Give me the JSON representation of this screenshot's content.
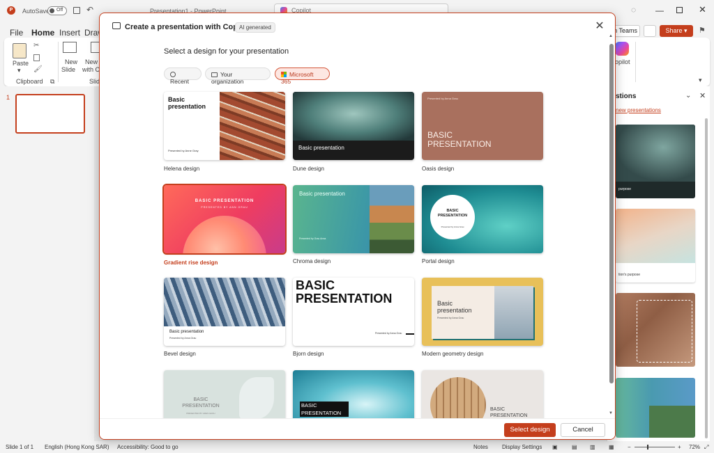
{
  "app": {
    "autosave_label": "AutoSave",
    "autosave_state": "Off",
    "doc_title": "Presentation1 - PowerPoint",
    "search_placeholder": "Copilot"
  },
  "ribbon_tabs": [
    "File",
    "Home",
    "Insert",
    "Draw"
  ],
  "ribbon": {
    "paste": "Paste",
    "clipboard": "Clipboard",
    "new_slide_1": "New",
    "new_slide_2": "Slide",
    "new_slide2_1": "New S",
    "new_slide2_2": "with C",
    "slides_group": "Slid",
    "teams": "n Teams",
    "share": "Share",
    "copilot": "opilot"
  },
  "slides_pane": {
    "slide_number": "1"
  },
  "side_pane": {
    "title": "stions",
    "link": "new presentations",
    "thumb1_text": "purpose",
    "thumb2_text": "tion's purpose"
  },
  "status": {
    "slide": "Slide 1 of 1",
    "language": "English (Hong Kong SAR)",
    "accessibility": "Accessibility: Good to go",
    "notes": "Notes",
    "display": "Display Settings",
    "zoom": "72%"
  },
  "dialog": {
    "title": "Create a presentation with Copilot",
    "badge": "AI generated",
    "heading": "Select a design for your presentation",
    "filters": [
      "Recent",
      "Your organization",
      "Microsoft 365"
    ],
    "select_button": "Select design",
    "cancel_button": "Cancel"
  },
  "designs": [
    {
      "name": "Helena design",
      "thumb_title": "Basic presentation",
      "thumb_sub": "Presented by Anne Gray"
    },
    {
      "name": "Dune design",
      "thumb_title": "Basic presentation",
      "thumb_sub": ""
    },
    {
      "name": "Oasis design",
      "thumb_title": "BASIC PRESENTATION",
      "thumb_sub": "Presented by Anna Grau"
    },
    {
      "name": "Gradient rise design",
      "thumb_title": "BASIC PRESENTATION",
      "thumb_sub": "PRESENTED BY ANN GRAU"
    },
    {
      "name": "Chroma design",
      "thumb_title": "Basic presentation",
      "thumb_sub": "Presented by Grau Anna"
    },
    {
      "name": "Portal design",
      "thumb_title": "BASIC PRESENTATION",
      "thumb_sub": "Presented by Anna Grau"
    },
    {
      "name": "Bevel design",
      "thumb_title": "Basic presentation",
      "thumb_sub": "Presented by Anna Grau"
    },
    {
      "name": "Bjorn design",
      "thumb_title": "BASIC PRESENTATION",
      "thumb_sub": "Presented by Anna Grau"
    },
    {
      "name": "Modern geometry design",
      "thumb_title": "Basic presentation",
      "thumb_sub": "Presented by Anna Grau"
    },
    {
      "name": "",
      "thumb_title": "BASIC PRESENTATION",
      "thumb_sub": "PRESENTED BY ARES GRAU"
    },
    {
      "name": "",
      "thumb_title": "BASIC PRESENTATION",
      "thumb_sub": ""
    },
    {
      "name": "",
      "thumb_title": "BASIC PRESENTATION",
      "thumb_sub": ""
    }
  ],
  "colors": {
    "accent": "#c43e1c",
    "selected_border": "#c43e1c"
  }
}
